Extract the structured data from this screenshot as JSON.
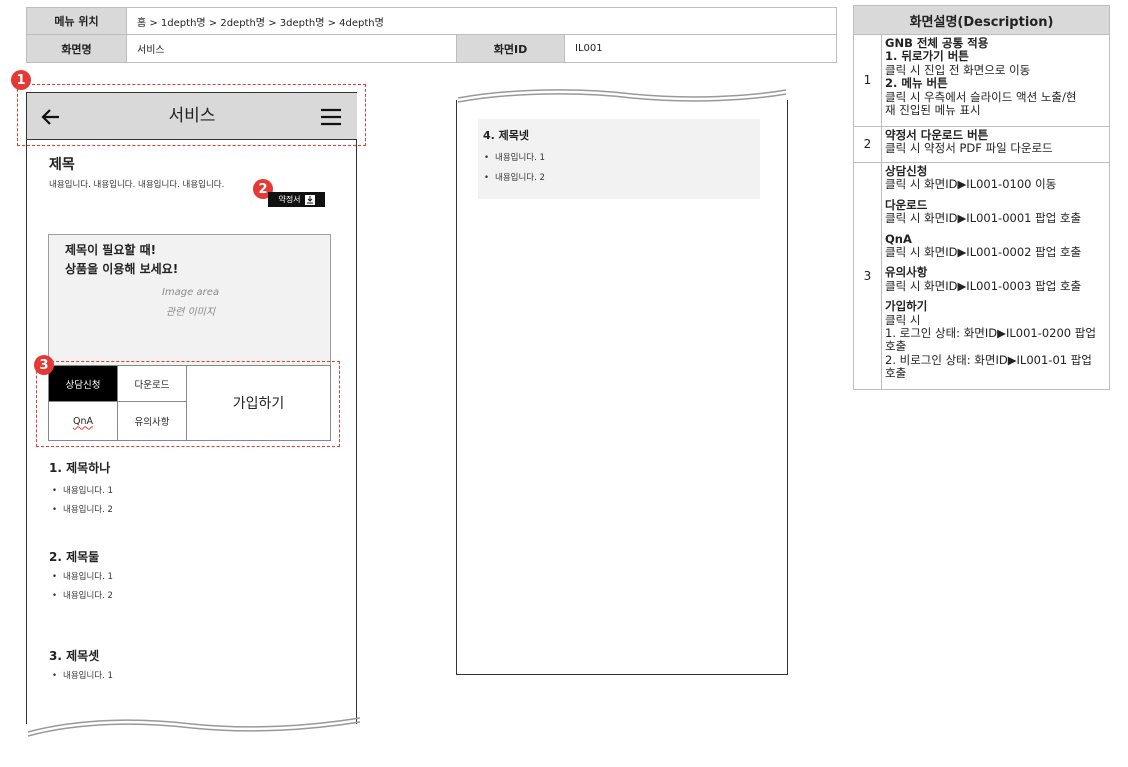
{
  "header_table": {
    "menu_location_label": "메뉴 위치",
    "menu_location_value": "홈 > 1depth명 > 2depth명 > 3depth명 > 4depth명",
    "screen_name_label": "화면명",
    "screen_name_value": "서비스",
    "screen_id_label": "화면ID",
    "screen_id_value": "IL001"
  },
  "markers": [
    "1",
    "2",
    "3"
  ],
  "appbar": {
    "title": "서비스",
    "back_icon": "arrow-left-icon",
    "menu_icon": "hamburger-icon"
  },
  "intro": {
    "title": "제목",
    "body": "내용입니다. 내용입니다. 내용입니다. 내용입니다.",
    "terms_button": "약정서"
  },
  "promo": {
    "line1": "제목이 필요할 때!",
    "line2": "상품을 이용해 보세요!",
    "img_label1": "Image area",
    "img_label2": "관련 이미지"
  },
  "action_grid": {
    "consult": "상담신청",
    "download": "다운로드",
    "qna": "QnA",
    "notice": "유의사항",
    "join": "가입하기"
  },
  "sections": [
    {
      "title": "1. 제목하나",
      "items": [
        "내용입니다. 1",
        "내용입니다. 2"
      ]
    },
    {
      "title": "2. 제목둘",
      "items": [
        "내용입니다. 1",
        "내용입니다. 2"
      ]
    },
    {
      "title": "3. 제목셋",
      "items": [
        "내용입니다. 1"
      ]
    }
  ],
  "continued": {
    "title": "4. 제목넷",
    "items": [
      "내용입니다. 1",
      "내용입니다. 2"
    ]
  },
  "description": {
    "header": "화면설명(Description)",
    "rows": [
      {
        "no": "1",
        "lines": [
          "GNB 전체 공통 적용",
          "1. 뒤로가기 버튼",
          "클릭 시 진입 전 화면으로 이동",
          "2. 메뉴 버튼",
          "클릭 시 우측에서 슬라이드 액션 노출/현",
          "재 진입된 메뉴 표시"
        ]
      },
      {
        "no": "2",
        "lines": [
          "약정서 다운로드 버튼",
          "클릭 시 약정서 PDF 파일 다운로드"
        ]
      },
      {
        "no": "3",
        "lines": [
          "상담신청",
          "클릭 시 화면ID▶IL001-0100 이동",
          "다운로드",
          "클릭 시 화면ID▶IL001-0001 팝업 호출",
          "QnA",
          "클릭 시 화면ID▶IL001-0002 팝업 호출",
          "유의사항",
          "클릭 시 화면ID▶IL001-0003 팝업 호출",
          "가입하기",
          "클릭 시",
          "1. 로그인 상태: 화면ID▶IL001-0200 팝업",
          "호출",
          "2. 비로그인 상태: 화면ID▶IL001-01 팝업",
          "호출"
        ]
      }
    ]
  },
  "colors": {
    "marker": "#e53935",
    "header_gray": "#d9d9d9",
    "consult_bg": "#000000"
  }
}
